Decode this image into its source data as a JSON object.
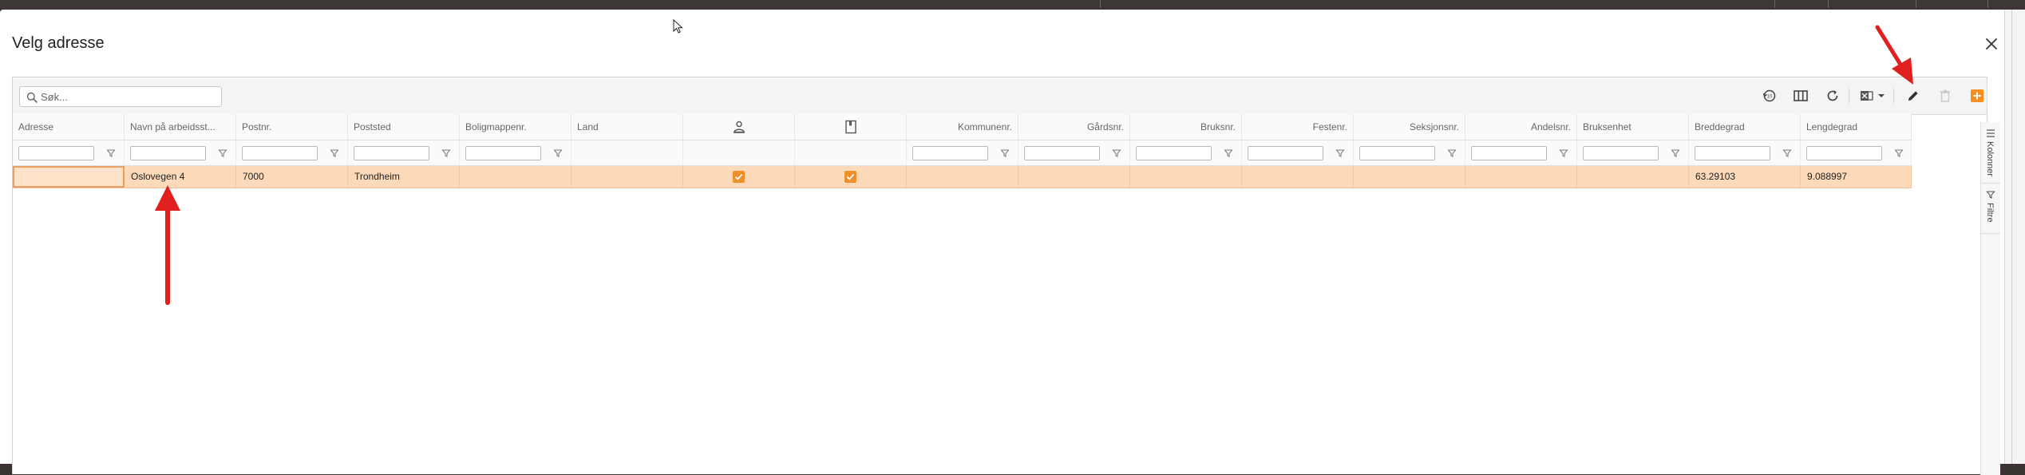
{
  "dialog": {
    "title": "Velg adresse",
    "close_icon": "close-icon"
  },
  "search": {
    "placeholder": "Søk..."
  },
  "toolbar": {
    "icons": [
      "history-icon",
      "columns-icon",
      "refresh-icon",
      "excel-export-icon",
      "edit-icon",
      "delete-icon",
      "add-icon"
    ],
    "accent_color": "#f5901e"
  },
  "columns": {
    "adresse": "Adresse",
    "navn": "Navn på arbeidsst...",
    "postnr": "Postnr.",
    "poststed": "Poststed",
    "boligmappenr": "Boligmappenr.",
    "land": "Land",
    "person_icon": "person-icon",
    "book_icon": "book-icon",
    "kommunenr": "Kommunenr.",
    "gardsnr": "Gårdsnr.",
    "bruksnr": "Bruksnr.",
    "festenr": "Festenr.",
    "seksjonsnr": "Seksjonsnr.",
    "andelsnr": "Andelsnr.",
    "bruksenhet": "Bruksenhet",
    "breddegrad": "Breddegrad",
    "lengdegrad": "Lengdegrad"
  },
  "row": {
    "adresse": "",
    "navn": "Oslovegen 4",
    "postnr": "7000",
    "poststed": "Trondheim",
    "boligmappenr": "",
    "land": "",
    "person_checked": true,
    "book_checked": true,
    "kommunenr": "",
    "gardsnr": "",
    "bruksnr": "",
    "festenr": "",
    "seksjonsnr": "",
    "andelsnr": "",
    "bruksenhet": "",
    "breddegrad": "63.29103",
    "lengdegrad": "9.088997"
  },
  "side_panel": {
    "kolonner": "Kolonner",
    "filtre": "Filtre"
  },
  "colors": {
    "row_highlight": "#fcd9b8",
    "checkbox": "#ef8f2a",
    "annotation_arrow": "#e01f1f"
  }
}
